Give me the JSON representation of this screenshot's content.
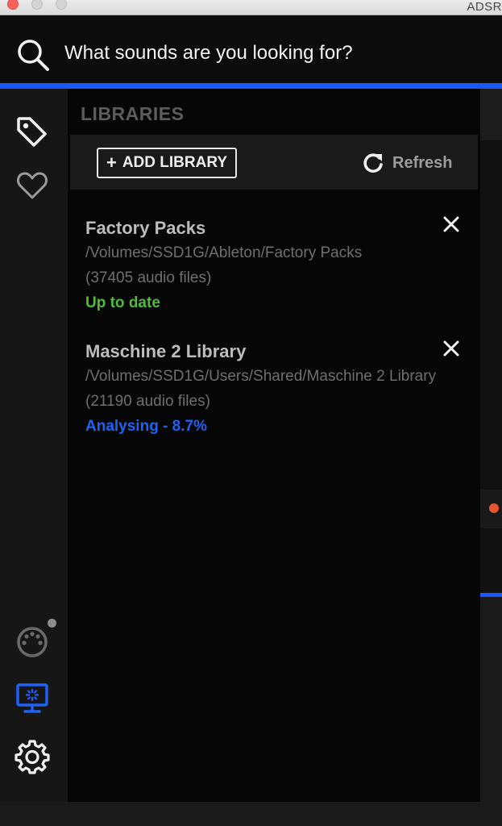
{
  "window": {
    "title": "ADSR"
  },
  "search": {
    "placeholder": "What sounds are you looking for?"
  },
  "sidebar": {
    "icons": [
      "tag-icon",
      "heart-icon",
      "midi-icon",
      "monitor-icon",
      "gear-icon"
    ],
    "active_icon": "monitor-icon"
  },
  "libraries": {
    "heading": "LIBRARIES",
    "add_label": "ADD LIBRARY",
    "refresh_label": "Refresh",
    "items": [
      {
        "name": "Factory Packs",
        "path": "/Volumes/SSD1G/Ableton/Factory Packs",
        "count": "(37405 audio files)",
        "status": "Up to date"
      },
      {
        "name": "Maschine 2 Library",
        "path": "/Volumes/SSD1G/Users/Shared/Maschine 2 Library",
        "count": "(21190 audio files)",
        "status": "Analysing - 8.7%"
      }
    ]
  },
  "colors": {
    "accent": "#1b57ff",
    "status_ok": "#4fbd3a",
    "status_progress": "#1e62f5",
    "record_dot": "#e9542f"
  }
}
